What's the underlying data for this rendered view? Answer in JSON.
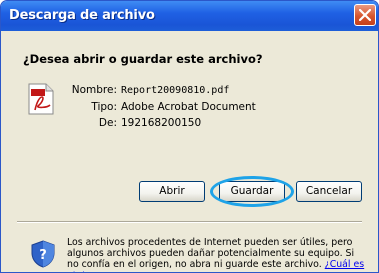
{
  "window": {
    "title": "Descarga de archivo",
    "close_icon": "close-icon"
  },
  "dialog": {
    "question": "¿Desea abrir o guardar este archivo?",
    "file_icon": "pdf-file-icon",
    "fields": {
      "name_label": "Nombre:",
      "name_value": "Report20090810.pdf",
      "type_label": "Tipo:",
      "type_value": "Adobe Acrobat Document",
      "from_label": "De:",
      "from_value": "192168200150"
    },
    "buttons": {
      "open": "Abrir",
      "save": "Guardar",
      "cancel": "Cancelar"
    },
    "highlight_color": "#1ea3e8"
  },
  "warning": {
    "icon": "shield-question-icon",
    "text": "Los archivos procedentes de Internet pueden ser útiles, pero algunos archivos pueden dañar potencialmente su equipo. Si no confía en el origen, no abra ni guarde este archivo.",
    "link": "¿Cuál es el riesgo?"
  }
}
